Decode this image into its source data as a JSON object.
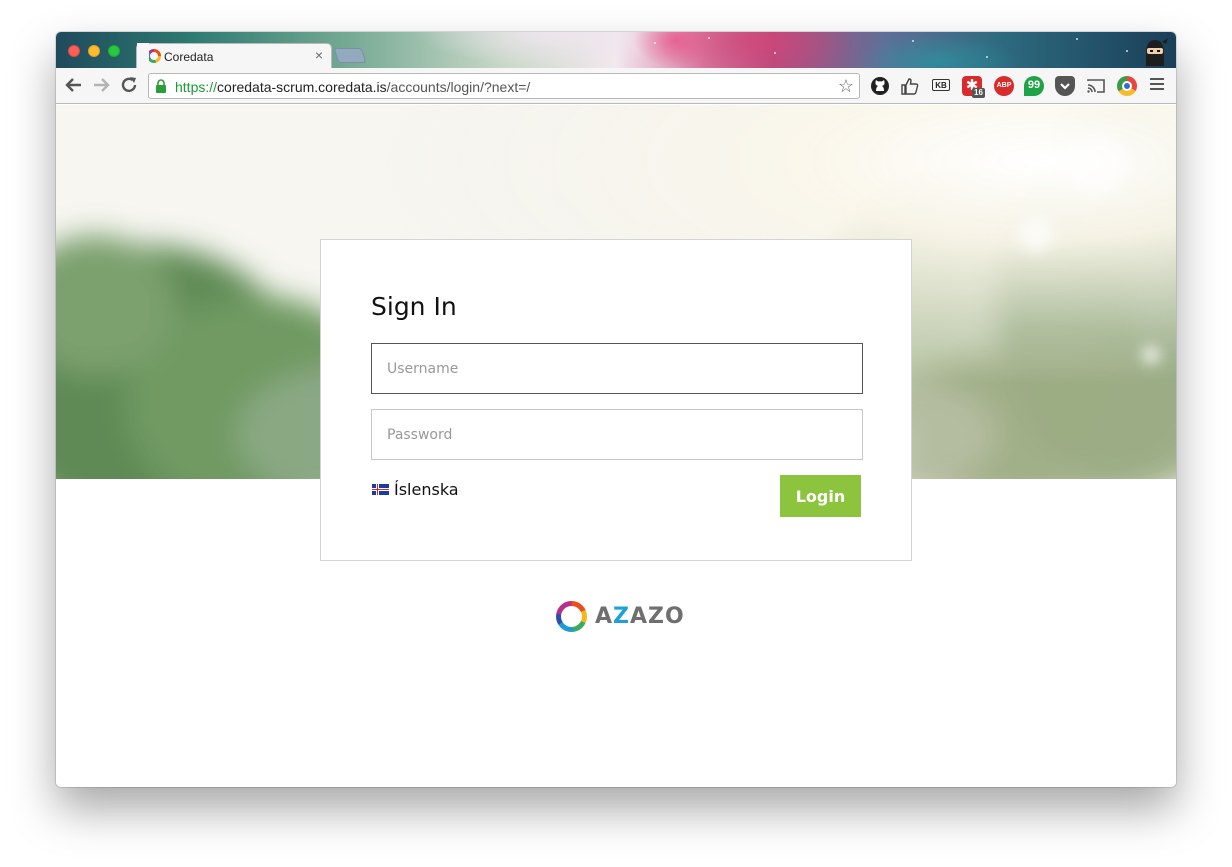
{
  "browser": {
    "tab": {
      "title": "Coredata",
      "close_glyph": "×"
    },
    "address": {
      "scheme": "https://",
      "host": "coredata-scrum.coredata.is",
      "path": "/accounts/login/?next=/"
    },
    "extensions": {
      "kb_label": "KB",
      "badge_count": "16",
      "abp_label": "ABP",
      "hangouts_glyph": "99"
    },
    "icons": [
      "back-arrow-icon",
      "forward-arrow-icon",
      "reload-icon",
      "lock-icon",
      "bookmark-star-icon",
      "github-icon",
      "thumbs-up-icon",
      "kb-icon",
      "red-star-extension-icon",
      "adblock-plus-icon",
      "hangouts-icon",
      "pocket-icon",
      "cast-icon",
      "chrome-ui-icon",
      "menu-icon"
    ]
  },
  "login": {
    "title": "Sign In",
    "username_placeholder": "Username",
    "password_placeholder": "Password",
    "language_label": "Íslenska",
    "login_button": "Login"
  },
  "brand": {
    "name_a": "A",
    "name_z": "Z",
    "name_rest": "AZO"
  },
  "colors": {
    "login_button": "#8cc43d",
    "brand_text": "#6f6f6f",
    "brand_z": "#1fa0d8",
    "secure_scheme": "#1c9b33"
  }
}
